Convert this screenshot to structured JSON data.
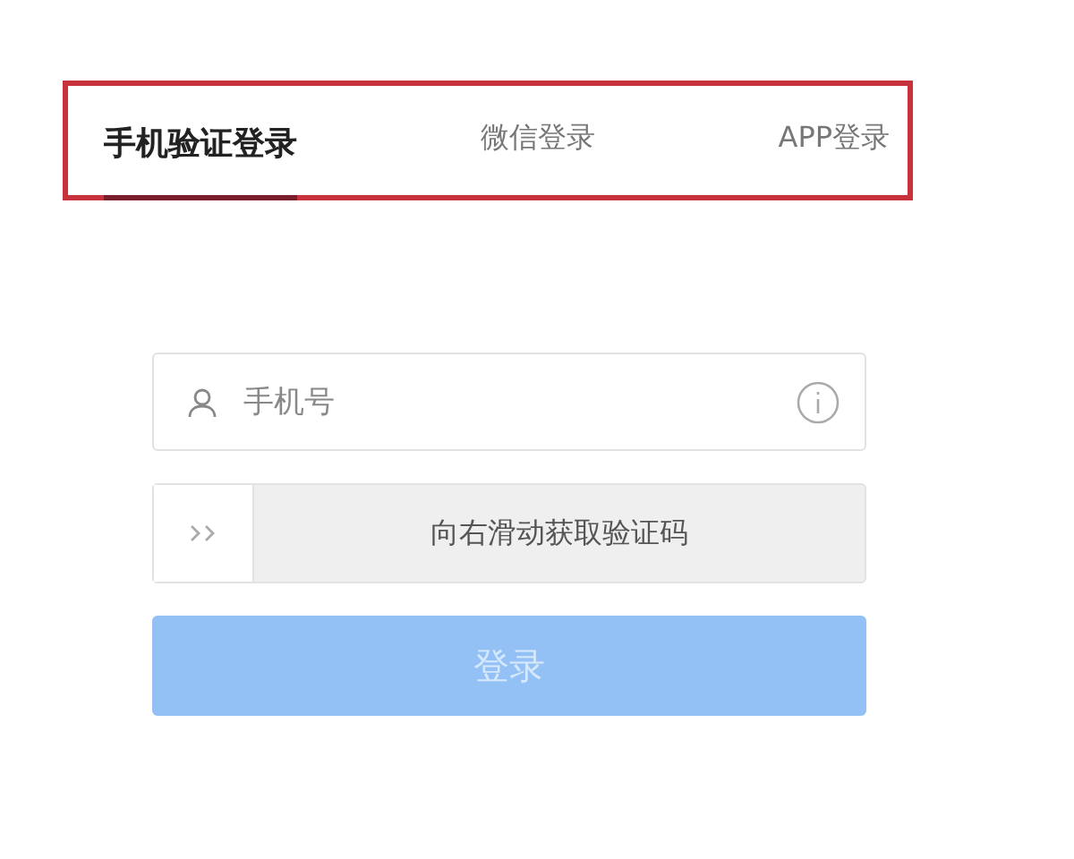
{
  "tabs": [
    {
      "label": "手机验证登录",
      "selected": true
    },
    {
      "label": "微信登录",
      "selected": false
    },
    {
      "label": "APP登录",
      "selected": false
    }
  ],
  "phone_field": {
    "placeholder": "手机号"
  },
  "slider": {
    "label": "向右滑动获取验证码",
    "level": 0
  },
  "login_button": {
    "label": "登录",
    "disabled": true
  }
}
